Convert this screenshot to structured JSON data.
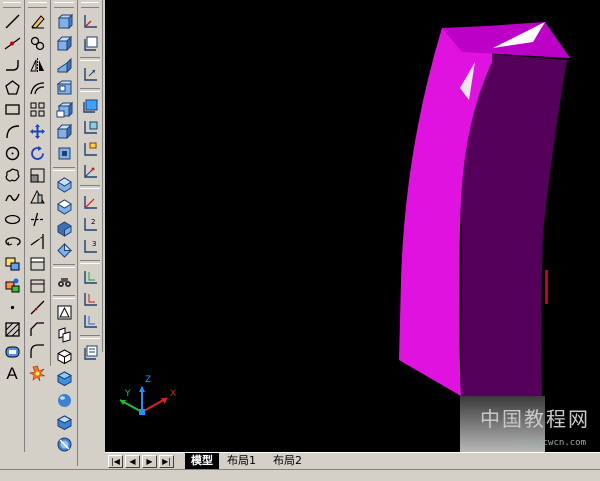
{
  "tabs": {
    "model": "模型",
    "layout1": "布局1",
    "layout2": "布局2"
  },
  "nav": {
    "first": "|◀",
    "prev": "◀",
    "next": "▶",
    "last": "▶|"
  },
  "draw_toolbar": {
    "text_tool": "A",
    "icons": [
      "line-icon",
      "construction-line-icon",
      "polyline-icon",
      "polygon-icon",
      "rectangle-icon",
      "arc-icon",
      "circle-icon",
      "revision-cloud-icon",
      "spline-icon",
      "ellipse-icon",
      "ellipse-arc-icon",
      "insert-block-icon",
      "make-block-icon",
      "point-icon",
      "hatch-icon",
      "region-icon",
      "multiline-text-icon"
    ]
  },
  "modify_toolbar": {
    "icons": [
      "erase-icon",
      "copy-icon",
      "mirror-icon",
      "offset-icon",
      "array-icon",
      "move-icon",
      "rotate-icon",
      "scale-icon",
      "stretch-icon",
      "trim-icon",
      "extend-icon",
      "break-at-point-icon",
      "break-icon",
      "join-icon",
      "chamfer-icon",
      "fillet-icon",
      "explode-icon"
    ]
  },
  "solids_toolbar": {
    "icons": [
      "polysolid-icon",
      "box-icon",
      "wedge-icon",
      "cone-icon",
      "sphere-icon",
      "cylinder-icon",
      "torus-icon",
      "pyramid-icon",
      "helix-icon",
      "planar-surface-icon",
      "extrude-icon",
      "revolve-icon",
      "sweep-icon",
      "loft-icon",
      "presspull-icon",
      "slice-icon",
      "section-plane-icon",
      "flatshot-icon",
      "union-icon",
      "subtract-icon",
      "intersect-icon"
    ]
  },
  "ucs_toolbar": {
    "icons": [
      "ucs-icon",
      "ucs-world-icon",
      "ucs-previous-icon",
      "ucs-face-icon",
      "ucs-object-icon",
      "ucs-view-icon",
      "ucs-origin-icon",
      "ucs-zaxis-icon",
      "ucs-3point-icon",
      "ucs-x-icon",
      "ucs-y-icon",
      "ucs-z-icon",
      "ucs-apply-icon",
      "named-ucs-icon"
    ]
  },
  "ucs_axes": {
    "x": "X",
    "y": "Y",
    "z": "Z"
  },
  "watermark": {
    "line1": "中国教程网",
    "line2": "www.jcwcn.com"
  },
  "colors": {
    "viewport_bg": "#000000",
    "solid_front": "#e012e0",
    "solid_side": "#54005a",
    "solid_top": "#bc00c8",
    "axis_x": "#e02020",
    "axis_y": "#20c020",
    "axis_z": "#2090ff"
  }
}
